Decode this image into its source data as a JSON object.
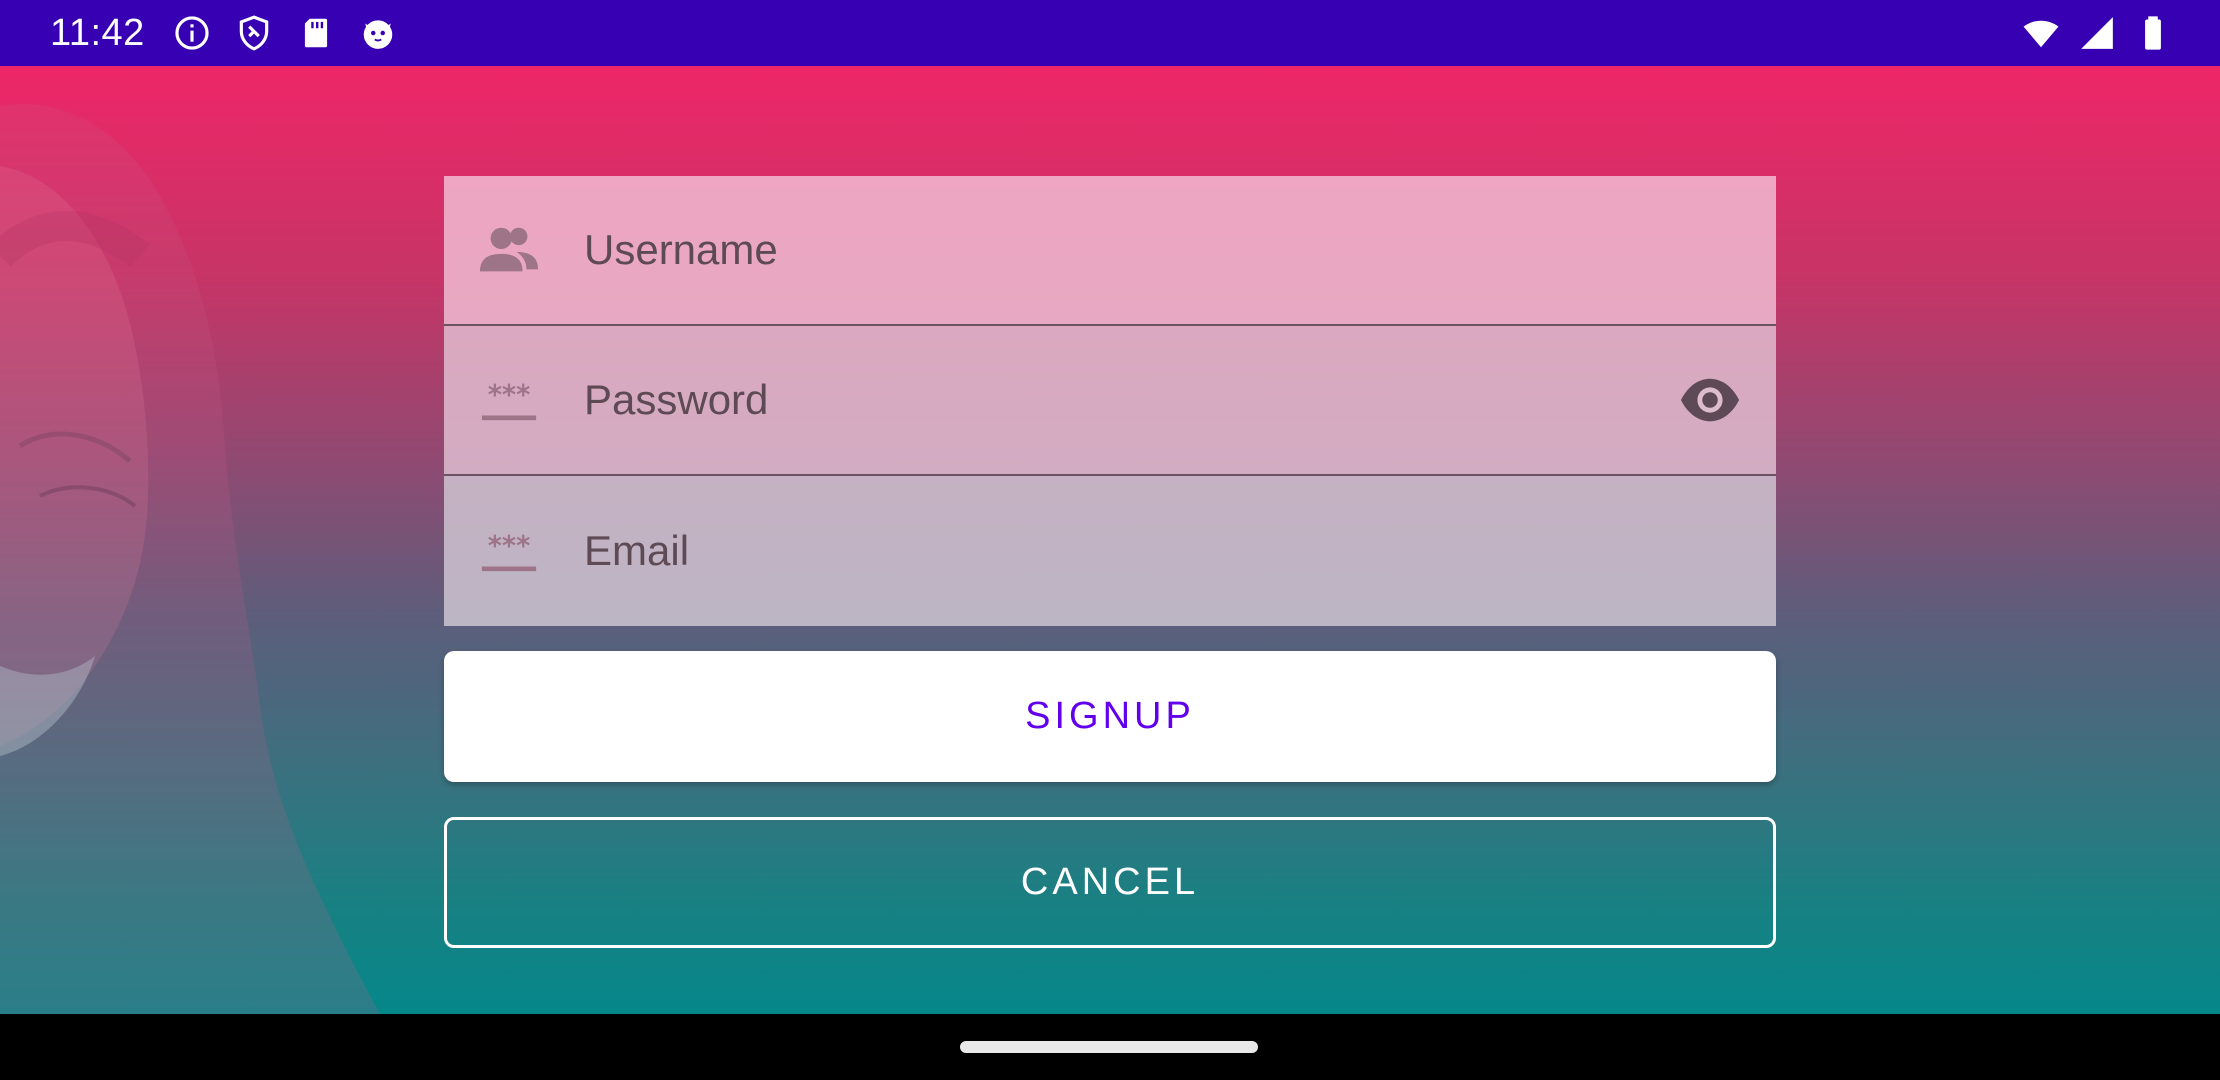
{
  "status_bar": {
    "time": "11:42",
    "left_icons": [
      "info-icon",
      "shield-icon",
      "sd-card-icon",
      "cat-icon"
    ],
    "right_icons": [
      "wifi-icon",
      "cellular-signal-icon",
      "battery-icon"
    ]
  },
  "form": {
    "username": {
      "placeholder": "Username",
      "icon": "people-icon"
    },
    "password": {
      "placeholder": "Password",
      "icon": "password-icon",
      "toggle_icon": "eye-icon"
    },
    "email": {
      "placeholder": "Email",
      "icon": "password-icon"
    }
  },
  "buttons": {
    "signup_label": "SIGNUP",
    "cancel_label": "CANCEL"
  },
  "colors": {
    "status_bar": "#3700b3",
    "gradient_top": "#ee2668",
    "gradient_bottom": "#05878a",
    "signup_text": "#6200ee"
  }
}
